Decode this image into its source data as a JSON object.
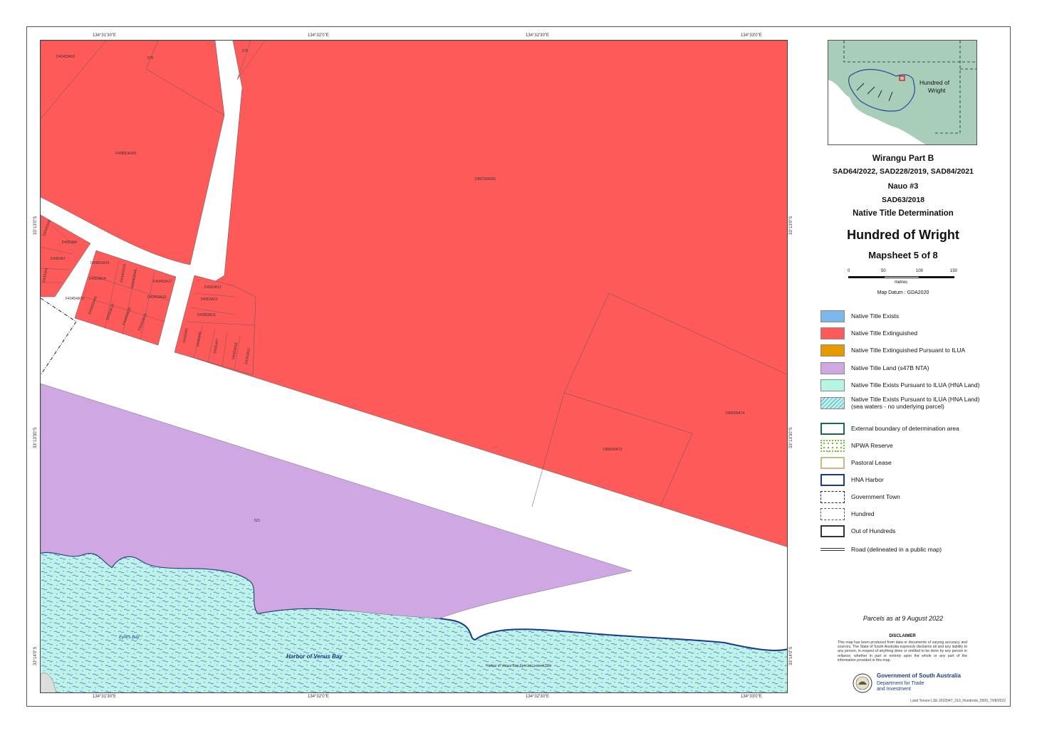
{
  "map": {
    "coords": {
      "top": [
        "134°31'30\"E",
        "134°32'0\"E",
        "134°32'30\"E",
        "134°33'0\"E"
      ],
      "bottom": [
        "134°31'30\"E",
        "134°32'0\"E",
        "134°32'30\"E",
        "134°33'0\"E"
      ],
      "left": [
        "33°13'0\"S",
        "33°13'30\"S",
        "33°14'0\"S"
      ],
      "right": [
        "33°13'0\"S",
        "33°13'30\"S",
        "33°14'0\"S"
      ]
    },
    "parcel_labels": [
      "D43453A52",
      "575",
      "575",
      "F4085DA365",
      "D89759A301",
      "D43453A9",
      "D4353A8",
      "D4353A7",
      "D4353A4",
      "D43853A10",
      "D4353A14",
      "D43453A15",
      "D43453A16",
      "D43453A17",
      "F43454A10",
      "D43453A40",
      "D4353A19",
      "F43454A20",
      "F43454A21",
      "D4353A12",
      "D4353A13",
      "D43853A11",
      "D43453A10",
      "D4353A5",
      "D4353A6",
      "D4353A7",
      "D4353A16",
      "D4353A17",
      "D89590A74",
      "D89590A73",
      "521"
    ],
    "water_labels": {
      "bay": "Harbor of Venus Bay",
      "point": "Eyre's Bay",
      "note": "Harbor of Venus Bay Special Leased Title"
    }
  },
  "inset": {
    "label": "Hundred of\nWright"
  },
  "titles": {
    "claim_1": "Wirangu Part B",
    "claim_1_ids": "SAD64/2022, SAD228/2019, SAD84/2021",
    "claim_2": "Nauo #3",
    "claim_2_id": "SAD63/2018",
    "determination": "Native Title Determination",
    "hundred": "Hundred of Wright",
    "mapsheet": "Mapsheet 5 of 8"
  },
  "scale": {
    "ticks": [
      "0",
      "50",
      "100",
      "150"
    ],
    "unit": "metres"
  },
  "datum": "Map Datum : GDA2020",
  "legend": [
    {
      "label": "Native Title Exists",
      "style": "fill",
      "color": "#7bb8ee"
    },
    {
      "label": "Native Title Extinguished",
      "style": "fill",
      "color": "#ff5a5a"
    },
    {
      "label": "Native Title Extinguished Pursuant to ILUA",
      "style": "fill",
      "color": "#e69a00"
    },
    {
      "label": "Native Title Land (s47B NTA)",
      "style": "fill",
      "color": "#cfa8e3"
    },
    {
      "label": "Native Title Exists Pursuant to ILUA (HNA Land)",
      "style": "fill",
      "color": "#b6f5e2"
    },
    {
      "label": "Native Title Exists Pursuant to ILUA (HNA Land)\n(sea waters - no underlying parcel)",
      "style": "pattern",
      "color": "#b6f5e2"
    },
    {
      "label": "External boundary of determination area",
      "style": "outline",
      "color": "#1b6b4a"
    },
    {
      "label": "NPWA Reserve",
      "style": "dots",
      "color": "#7ab648"
    },
    {
      "label": "Pastoral Lease",
      "style": "outline",
      "color": "#c8b98a"
    },
    {
      "label": "HNA Harbor",
      "style": "outline",
      "color": "#1a3a8a"
    },
    {
      "label": "Government Town",
      "style": "dashdot",
      "color": "#222222"
    },
    {
      "label": "Hundred",
      "style": "dashed",
      "color": "#555555"
    },
    {
      "label": "Out of Hundreds",
      "style": "outline",
      "color": "#333333"
    },
    {
      "label": "Road (delineated in a public map)",
      "style": "road",
      "color": "#333333"
    }
  ],
  "parcels_date": "Parcels as at 9 August 2022",
  "disclaimer": {
    "title": "DISCLAIMER",
    "text": "This map has been produced from data or documents of varying accuracy and sources. The State of South Australia expressly disclaims all and any liability to any person, in respect of anything done or omitted to be done by any person in reliance, whether in part or entirely upon the whole or any part of the information provided in this map."
  },
  "government": {
    "name": "Government of South Australia",
    "dept": "Department for Trade\nand Investment"
  },
  "footer": "Land Tenure LSE 2022047_310_Hundreds_5500_7/08/2022"
}
